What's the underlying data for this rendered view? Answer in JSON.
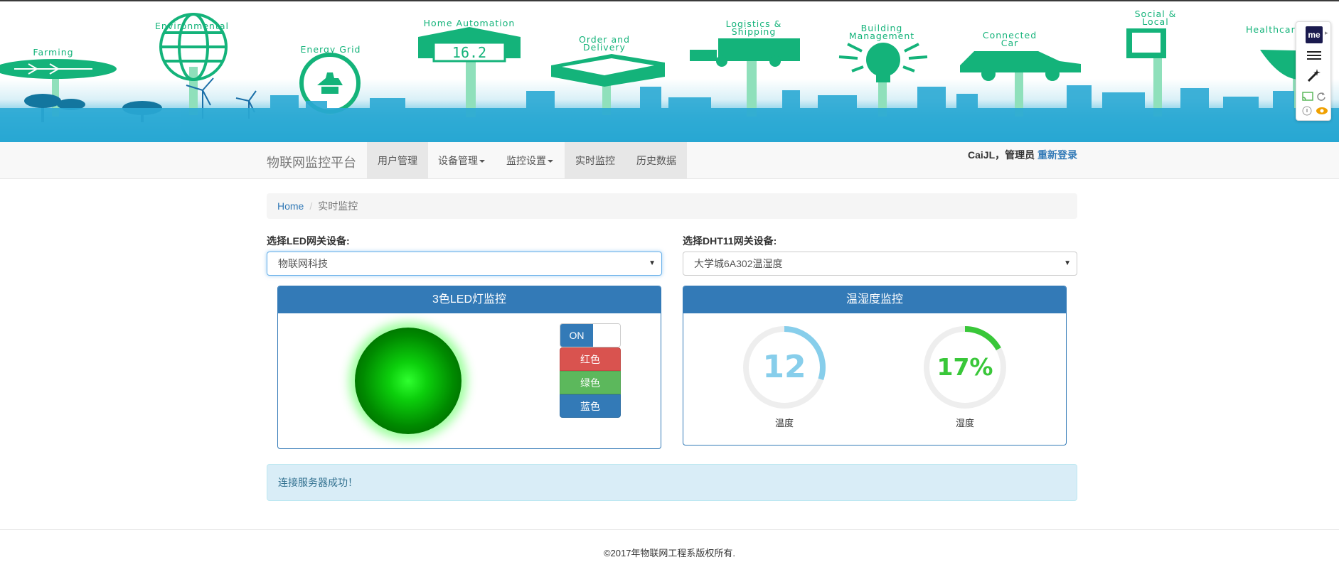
{
  "banner": {
    "labels": [
      "Farming",
      "Environmental",
      "Energy Grid",
      "Home Automation",
      "Order and\nDelivery",
      "Logistics &\nShipping",
      "Building\nManagement",
      "Connected\nCar",
      "Social &\nLocal",
      "Healthcare"
    ],
    "display_reading": "16.2",
    "accent_color": "#14b37a"
  },
  "side_widget": {
    "logo_text": "me",
    "icons": [
      "menu-icon",
      "magic-wand-icon",
      "cast-icon",
      "refresh-icon",
      "info-icon",
      "eye-icon"
    ]
  },
  "navbar": {
    "brand": "物联网监控平台",
    "items": [
      {
        "label": "用户管理",
        "active": true,
        "dropdown": false
      },
      {
        "label": "设备管理",
        "active": false,
        "dropdown": true
      },
      {
        "label": "监控设置",
        "active": false,
        "dropdown": true
      },
      {
        "label": "实时监控",
        "active": true,
        "dropdown": false
      },
      {
        "label": "历史数据",
        "active": true,
        "dropdown": false
      }
    ],
    "user_text": "CaiJL，管理员",
    "relogin_label": "重新登录"
  },
  "breadcrumb": {
    "home": "Home",
    "separator": "/",
    "current": "实时监控"
  },
  "led_device": {
    "label": "选择LED网关设备:",
    "selected": "物联网科技"
  },
  "dht_device": {
    "label": "选择DHT11网关设备:",
    "selected": "大学城6A302温湿度"
  },
  "led_panel": {
    "title": "3色LED灯监控",
    "switch_label": "ON",
    "switch_state": "on",
    "led_color": "#00e000",
    "buttons": {
      "red": "红色",
      "green": "绿色",
      "blue": "蓝色"
    },
    "button_colors": {
      "red": "#d9534f",
      "green": "#5cb85c",
      "blue": "#337ab7"
    }
  },
  "dht_panel": {
    "title": "温湿度监控",
    "temperature": {
      "value": "12",
      "label": "温度",
      "fraction": 0.3,
      "color": "#87ceeb"
    },
    "humidity": {
      "value": "17%",
      "label": "湿度",
      "fraction": 0.17,
      "color": "#39c739"
    }
  },
  "alert": {
    "message": "连接服务器成功！"
  },
  "footer": {
    "text": "©2017年物联网工程系版权所有."
  }
}
